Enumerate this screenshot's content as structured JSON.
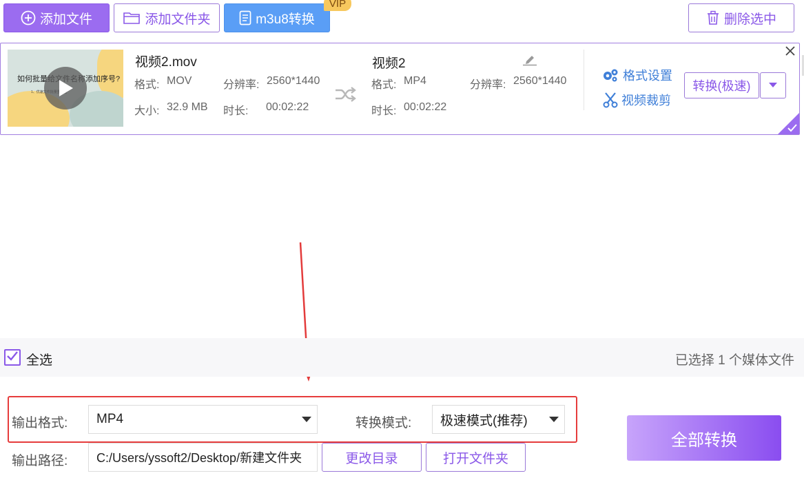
{
  "toolbar": {
    "add_file": "添加文件",
    "add_folder": "添加文件夹",
    "m3u8": "m3u8转换",
    "vip": "VIP",
    "delete_selected": "删除选中"
  },
  "file": {
    "thumb_title": "如何批量给文件名称添加序号?",
    "thumb_sub": "1、优速文件批量重命名",
    "source": {
      "name": "视频2.mov",
      "format_label": "格式:",
      "format": "MOV",
      "resolution_label": "分辨率:",
      "resolution": "2560*1440",
      "size_label": "大小:",
      "size": "32.9 MB",
      "duration_label": "时长:",
      "duration": "00:02:22"
    },
    "target": {
      "name": "视频2",
      "format_label": "格式:",
      "format": "MP4",
      "resolution_label": "分辨率:",
      "resolution": "2560*1440",
      "duration_label": "时长:",
      "duration": "00:02:22"
    },
    "format_settings": "格式设置",
    "video_crop": "视频裁剪",
    "convert_button": "转换(极速)"
  },
  "selection": {
    "select_all": "全选",
    "count_text": "已选择 1 个媒体文件"
  },
  "options": {
    "output_format_label": "输出格式:",
    "output_format": "MP4",
    "convert_mode_label": "转换模式:",
    "convert_mode": "极速模式(推荐)",
    "output_path_label": "输出路径:",
    "output_path": "C:/Users/yssoft2/Desktop/新建文件夹",
    "change_dir": "更改目录",
    "open_folder": "打开文件夹",
    "convert_all": "全部转换"
  },
  "colors": {
    "accent": "#8a58e8",
    "link": "#3f7fd8",
    "highlight": "#e63b3b"
  }
}
